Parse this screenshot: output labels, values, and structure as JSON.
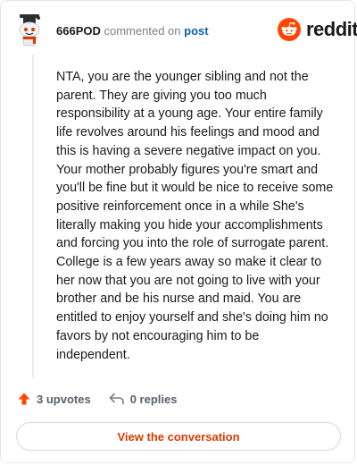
{
  "header": {
    "username": "666POD",
    "action_text": "commented on",
    "post_link": "post",
    "brand": "reddit"
  },
  "comment": {
    "body": "NTA, you are the younger sibling and not the parent. They are giving you too much responsibility at a young age. Your entire family life revolves around his feelings and mood and this is having a severe negative impact on you. Your mother probably figures you're smart and you'll be fine but it would be nice to receive some positive reinforcement once in a while She's literally making you hide your accomplishments and forcing you into the role of surrogate parent. College is a few years away so make it clear to her now that you are not going to live with your brother and be his nurse and maid. You are entitled to enjoy yourself and she's doing him no favors by not encouraging him to be independent."
  },
  "footer": {
    "upvotes": "3 upvotes",
    "replies": "0 replies"
  },
  "button": {
    "view_label": "View the conversation"
  },
  "colors": {
    "accent": "#d93a00",
    "brand_orange": "#ff4500",
    "link": "#0f5fb3"
  },
  "icons": {
    "avatar": "snoo-avatar",
    "logo": "reddit-alien-icon",
    "upvote": "upvote-arrow-icon",
    "reply": "reply-arrow-icon"
  }
}
